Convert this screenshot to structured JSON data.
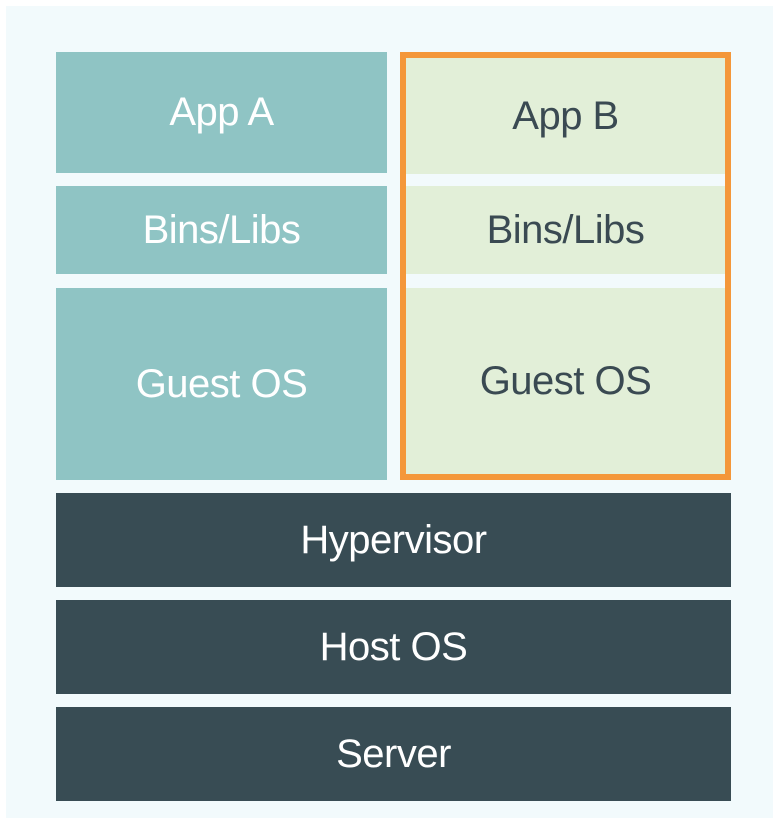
{
  "vm_a": {
    "app": "App A",
    "bins": "Bins/Libs",
    "guest_os": "Guest OS"
  },
  "vm_b": {
    "app": "App B",
    "bins": "Bins/Libs",
    "guest_os": "Guest OS"
  },
  "stack": {
    "hypervisor": "Hypervisor",
    "host_os": "Host OS",
    "server": "Server"
  },
  "colors": {
    "vm_a_fill": "#8fc4c4",
    "vm_b_fill": "#e2efd8",
    "infra_fill": "#384c54",
    "highlight_border": "#f4973a",
    "background": "#f2fafc"
  }
}
